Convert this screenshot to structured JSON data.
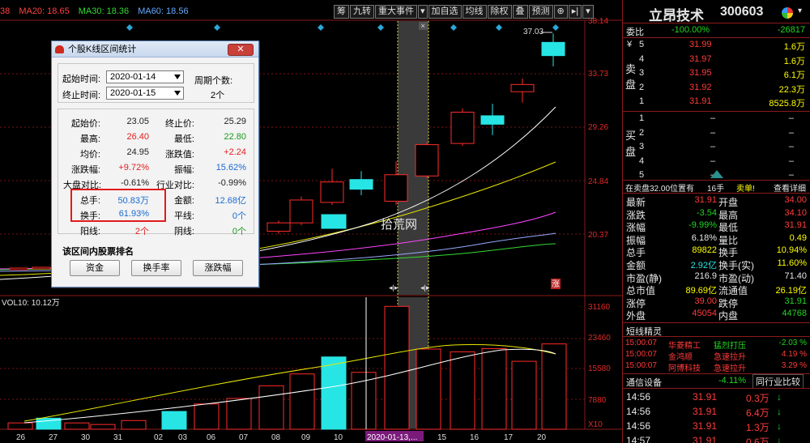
{
  "stock": {
    "name": "立昂技术",
    "code": "300603"
  },
  "ma_bar": {
    "ma20": "MA20: 18.65",
    "ma30": "MA30: 18.36",
    "ma60": "MA60: 18.56",
    "left": "38"
  },
  "toolbar": [
    "筹",
    "九转",
    "重大事件",
    "加自选",
    "均线",
    "除权",
    "叠",
    "预测"
  ],
  "chart_data": {
    "type": "candlestick",
    "price_axis": [
      "38.14",
      "33.73",
      "29.26",
      "24.84",
      "20.37"
    ],
    "volume_axis": [
      "31160",
      "23460",
      "15580",
      "7880",
      "X10"
    ],
    "x_labels": [
      "26",
      "27",
      "30",
      "31",
      "02",
      "03",
      "06",
      "07",
      "08",
      "09",
      "10",
      "2020-01-13,...",
      "15",
      "16",
      "17",
      "20"
    ],
    "high_marker": "37.03",
    "candles": [
      {
        "o": 20.6,
        "c": 21.3,
        "h": 21.5,
        "l": 20.4
      },
      {
        "o": 21.3,
        "c": 23.2,
        "h": 23.5,
        "l": 21.1
      },
      {
        "o": 23.0,
        "c": 24.7,
        "h": 25.8,
        "l": 22.8
      },
      {
        "o": 24.9,
        "c": 24.1,
        "h": 25.6,
        "l": 23.6
      },
      {
        "o": 23.1,
        "c": 25.3,
        "h": 26.4,
        "l": 22.8
      },
      {
        "o": 25.2,
        "c": 27.8,
        "h": 28.0,
        "l": 25.0
      },
      {
        "o": 27.9,
        "c": 30.5,
        "h": 30.8,
        "l": 27.7
      },
      {
        "o": 30.2,
        "c": 29.5,
        "h": 31.2,
        "l": 28.6
      },
      {
        "o": 32.2,
        "c": 32.8,
        "h": 33.3,
        "l": 31.3
      },
      {
        "o": 36.3,
        "c": 35.2,
        "h": 37.03,
        "l": 34.3
      }
    ],
    "volumes": [
      5200,
      6400,
      3200,
      2800,
      6000,
      10300,
      13800,
      14800,
      18300,
      20400,
      31100,
      24400,
      22600,
      19500,
      17200,
      21000
    ],
    "vol_label": "VOL10: 10.12万",
    "watermark": "拾荒网",
    "zhang_tag": "涨"
  },
  "dialog": {
    "title": "个股K线区间统计",
    "start_label": "起始时间:",
    "start_date": "2020-01-14",
    "end_label": "终止时间:",
    "end_date": "2020-01-15",
    "period_label": "周期个数:",
    "period_value": "2个",
    "rows": [
      {
        "l1": "起始价:",
        "v1": "23.05",
        "c1": "#222",
        "l2": "终止价:",
        "v2": "25.29",
        "c2": "#222"
      },
      {
        "l1": "最高:",
        "v1": "26.40",
        "c1": "#e02020",
        "l2": "最低:",
        "v2": "22.80",
        "c2": "#1a9a1a"
      },
      {
        "l1": "均价:",
        "v1": "24.95",
        "c1": "#222",
        "l2": "涨跌值:",
        "v2": "+2.24",
        "c2": "#e02020"
      },
      {
        "l1": "涨跌幅:",
        "v1": "+9.72%",
        "c1": "#e02020",
        "l2": "振幅:",
        "v2": "15.62%",
        "c2": "#1a6ad0"
      },
      {
        "l1": "大盘对比:",
        "v1": "-0.61%",
        "c1": "#222",
        "l2": "行业对比:",
        "v2": "-0.99%",
        "c2": "#222"
      },
      {
        "l1": "总手:",
        "v1": "50.83万",
        "c1": "#1a6ad0",
        "l2": "金额:",
        "v2": "12.68亿",
        "c2": "#1a6ad0"
      },
      {
        "l1": "换手:",
        "v1": "61.93%",
        "c1": "#1a6ad0",
        "l2": "平线:",
        "v2": "0个",
        "c2": "#1a6ad0"
      },
      {
        "l1": "阳线:",
        "v1": "2个",
        "c1": "#e02020",
        "l2": "阴线:",
        "v2": "0个",
        "c2": "#1a9a1a"
      }
    ],
    "rank_label": "该区间内股票排名",
    "btn_fund": "资金",
    "btn_turnover": "换手率",
    "btn_change": "涨跌幅"
  },
  "orderbook": {
    "weibi_label": "委比",
    "weibi_val": "-100.00%",
    "weibi_diff": "-26817",
    "sell_label": "卖盘",
    "buy_label": "买盘",
    "asks": [
      {
        "lvl": "5",
        "price": "31.99",
        "vol": "1.6万"
      },
      {
        "lvl": "4",
        "price": "31.97",
        "vol": "1.6万"
      },
      {
        "lvl": "3",
        "price": "31.95",
        "vol": "6.1万"
      },
      {
        "lvl": "2",
        "price": "31.92",
        "vol": "22.3万"
      },
      {
        "lvl": "1",
        "price": "31.91",
        "vol": "8525.8万"
      }
    ],
    "bids": [
      {
        "lvl": "1",
        "price": "–",
        "vol": "–"
      },
      {
        "lvl": "2",
        "price": "–",
        "vol": "–"
      },
      {
        "lvl": "3",
        "price": "–",
        "vol": "–"
      },
      {
        "lvl": "4",
        "price": "–",
        "vol": "–"
      },
      {
        "lvl": "5",
        "price": "–",
        "vol": "–"
      }
    ],
    "sell_info": "在卖盘32.00位置有",
    "sell_count": "16手",
    "sell_tag": "卖单!",
    "detail": "查看详细"
  },
  "quote": [
    {
      "l1": "最新",
      "v1": "31.91",
      "c1": "red",
      "l2": "开盘",
      "v2": "34.00",
      "c2": "red"
    },
    {
      "l1": "涨跌",
      "v1": "-3.54",
      "c1": "grn",
      "l2": "最高",
      "v2": "34.10",
      "c2": "red"
    },
    {
      "l1": "涨幅",
      "v1": "-9.99%",
      "c1": "grn",
      "l2": "最低",
      "v2": "31.91",
      "c2": "red"
    },
    {
      "l1": "振幅",
      "v1": "6.18%",
      "c1": "wht",
      "l2": "量比",
      "v2": "0.49",
      "c2": "yel"
    },
    {
      "l1": "总手",
      "v1": "89822",
      "c1": "yel",
      "l2": "换手",
      "v2": "10.94%",
      "c2": "yel"
    },
    {
      "l1": "金额",
      "v1": "2.92亿",
      "c1": "cy",
      "l2": "换手(实)",
      "v2": "11.60%",
      "c2": "yel"
    },
    {
      "l1": "市盈(静)",
      "v1": "216.9",
      "c1": "wht",
      "l2": "市盈(动)",
      "v2": "71.40",
      "c2": "wht"
    },
    {
      "l1": "总市值",
      "v1": "89.69亿",
      "c1": "yel",
      "l2": "流通值",
      "v2": "26.19亿",
      "c2": "yel"
    },
    {
      "l1": "涨停",
      "v1": "39.00",
      "c1": "red",
      "l2": "跌停",
      "v2": "31.91",
      "c2": "grn"
    },
    {
      "l1": "外盘",
      "v1": "45054",
      "c1": "red",
      "l2": "内盘",
      "v2": "44768",
      "c2": "grn"
    }
  ],
  "short_sprite": {
    "title": "短线精灵",
    "rows": [
      {
        "time": "15:00:07",
        "name": "华菱精工",
        "event": "猛烈打压",
        "val": "-2.03 %",
        "c": "grn"
      },
      {
        "time": "15:00:07",
        "name": "金鸿顺",
        "event": "急速拉升",
        "val": "4.19 %",
        "c": "red"
      },
      {
        "time": "15:00:07",
        "name": "阿博科技",
        "event": "急速拉升",
        "val": "3.29 %",
        "c": "red"
      }
    ]
  },
  "industry": {
    "name": "通信设备",
    "change": "-4.11%",
    "link": "同行业比较"
  },
  "ticks": [
    {
      "time": "14:56",
      "price": "31.91",
      "vol": "0.3万"
    },
    {
      "time": "14:56",
      "price": "31.91",
      "vol": "6.4万"
    },
    {
      "time": "14:56",
      "price": "31.91",
      "vol": "1.3万"
    },
    {
      "time": "14:57",
      "price": "31.91",
      "vol": "0.6万"
    }
  ]
}
